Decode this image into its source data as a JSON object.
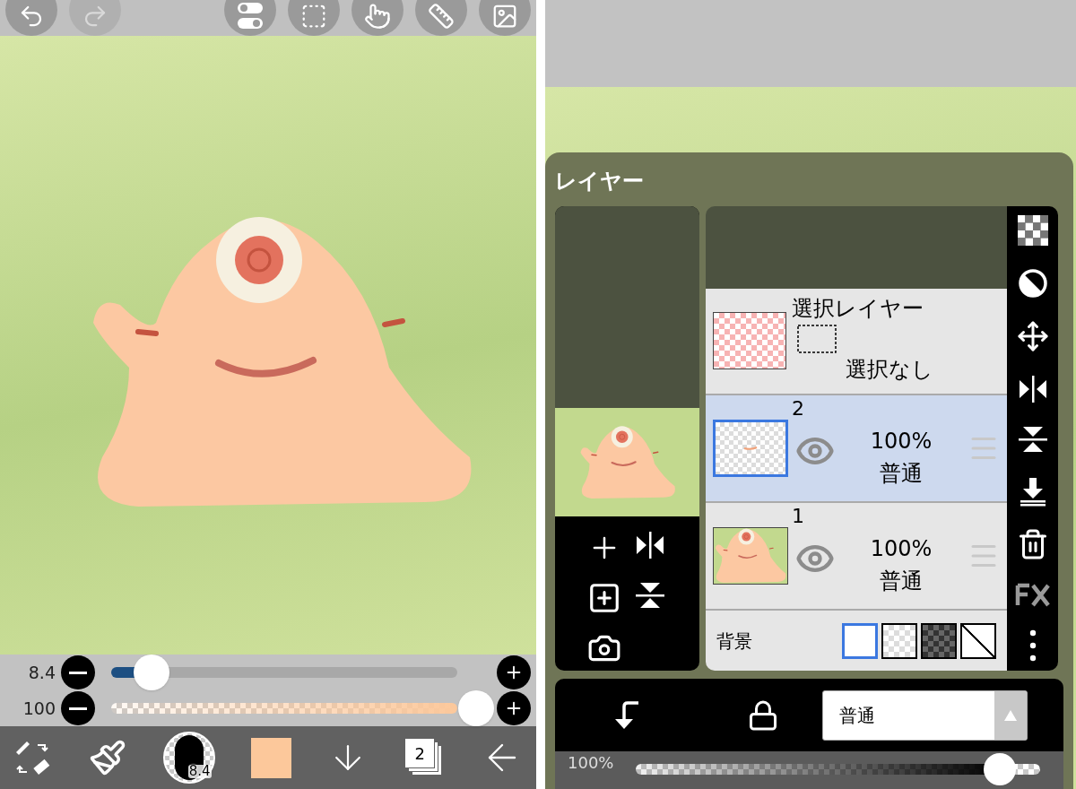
{
  "left_screen": {
    "top_toolbar": [
      {
        "kind": "undo",
        "disabled": false
      },
      {
        "kind": "redo",
        "disabled": true
      },
      {
        "kind": "toggles",
        "disabled": false
      },
      {
        "kind": "selection",
        "disabled": false
      },
      {
        "kind": "touch",
        "disabled": false
      },
      {
        "kind": "ruler",
        "disabled": false
      },
      {
        "kind": "image",
        "disabled": false
      }
    ],
    "brush_size": {
      "reading": "8.4",
      "level": 0.11
    },
    "brush_opacity": {
      "reading": "100",
      "level": 1
    },
    "bottom_toolbar": {
      "brush_size_badge": "8.4",
      "layer_count": "2"
    }
  },
  "right_screen": {
    "layer_panel": {
      "title": "レイヤー",
      "selection_layer": {
        "name": "選択レイヤー",
        "status": "選択なし"
      },
      "layers": [
        {
          "number": "2",
          "opacity": "100%",
          "blend": "普通",
          "selected": true
        },
        {
          "number": "1",
          "opacity": "100%",
          "blend": "普通",
          "selected": false
        }
      ],
      "background": {
        "label": "背景",
        "options": [
          {
            "kind": "white",
            "selected": true
          },
          {
            "kind": "transparent",
            "selected": false
          },
          {
            "kind": "dark",
            "selected": false
          },
          {
            "kind": "none",
            "selected": false
          }
        ]
      },
      "blend_mode_select": {
        "value": "普通"
      },
      "layer_opacity": {
        "reading": "100%",
        "level": 0.9
      }
    }
  }
}
